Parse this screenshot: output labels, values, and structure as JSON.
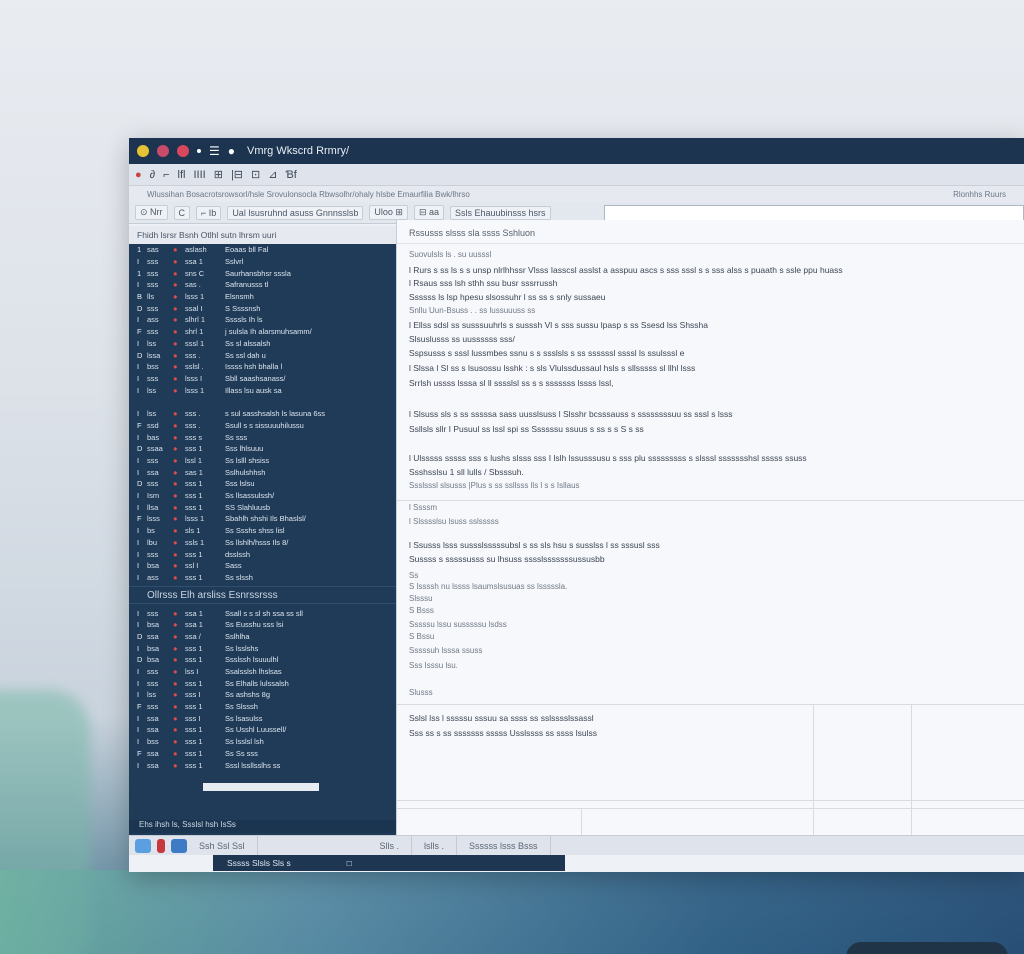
{
  "window": {
    "title": "Vmrg Wkscrd Rrmry/",
    "titlebar_colors": [
      "#e6c235",
      "#c94a6b",
      "#d8475c"
    ]
  },
  "toolbar": {
    "items": [
      "●",
      "∂",
      "⌐",
      "lfl",
      "IIII",
      "⊞",
      "|⊟",
      "⊡",
      "⊿",
      "Ɓf"
    ]
  },
  "pathbar": {
    "left": "Wlussihan Bosacrotsrowsorl/hsle Srovulonsocla Rbwsolhr/ohaly hlsbe Emaurfilia Bwk/lhrso",
    "right": "Rlonhhs Ruurs"
  },
  "navbar": {
    "back": "⊙ Nrr",
    "c": "C",
    "path1": "⌐ Ib",
    "crumbs": "Ual lsusruhnd asuss Gnnnsslsb",
    "grid": "Uloo ⊞",
    "folder": "⊟ aa",
    "item3": "Ssls Ehauubinsss hsrs",
    "address": ""
  },
  "sidebar": {
    "header": "Fhidh lsrsr Bsnh Otlhl sutn lhrsm uuri",
    "rows": [
      [
        "1",
        "sas",
        "●",
        "aslash",
        "Eoaas bll Fal"
      ],
      [
        "I",
        "sss",
        "●",
        "ssa  1",
        "Sslvrl"
      ],
      [
        "1",
        "sss",
        "●",
        "sns  C",
        "Saurhansbhsr sssla"
      ],
      [
        "I",
        "sss",
        "●",
        "sas  .",
        "Safranusss tl"
      ],
      [
        "B",
        "lls",
        "●",
        "lsss  1",
        "Elsnsmh"
      ],
      [
        "D",
        "sss",
        "●",
        "ssal  I",
        "S Ssssnsh"
      ],
      [
        "I",
        "ass",
        "●",
        "slhrl  1",
        "Ssssls Ih ls"
      ],
      [
        "F",
        "sss",
        "●",
        "shrl  1",
        "j sulsla Ih alarsmuhsamm/"
      ],
      [
        "I",
        "lss",
        "●",
        "sssl  1",
        "Ss sl alssalsh"
      ],
      [
        "D",
        "lssa",
        "●",
        "sss  .",
        "Ss ssl dah u"
      ],
      [
        "I",
        "bss",
        "●",
        "sslsl  .",
        "Issss hsh bhalla  l"
      ],
      [
        "I",
        "sss",
        "●",
        "lsss  I",
        "Sbll saashsanass/"
      ],
      [
        "I",
        "lss",
        "●",
        "lsss  1",
        "Illass lsu ausk sa"
      ]
    ],
    "rows2": [
      [
        "I",
        "lss",
        "●",
        "sss  .",
        "s sul sasshsalsh ls lasuna 6ss"
      ],
      [
        "F",
        "ssd",
        "●",
        "sss  .",
        "Ssull s s sissuuuhilussu"
      ],
      [
        "I",
        "bas",
        "●",
        "sss  s",
        "Ss sss"
      ],
      [
        "D",
        "ssaa",
        "●",
        "sss  1",
        "Sss lhlsuuu"
      ],
      [
        "I",
        "sss",
        "●",
        "lssl  1",
        "Ss lslll shsiss"
      ],
      [
        "I",
        "ssa",
        "●",
        "sas  1",
        "Sslhulshhsh"
      ],
      [
        "D",
        "sss",
        "●",
        "sss  1",
        "Sss lslsu"
      ],
      [
        "I",
        "Ism",
        "●",
        "sss  1",
        "Ss llsassulssh/"
      ],
      [
        "I",
        "llsa",
        "●",
        "sss  1",
        "SS Slahluusb"
      ],
      [
        "F",
        "lsss",
        "●",
        "lsss  1",
        "Sbahlh shshi Ils Bhaslsl/"
      ],
      [
        "I",
        "bs",
        "●",
        "sls  1",
        "Ss Ssshs shss lisl"
      ],
      [
        "I",
        "lbu",
        "●",
        "ssls  1",
        "Ss llshlh/hsss Ils 8/"
      ],
      [
        "I",
        "sss",
        "●",
        "sss  1",
        "dsslssh"
      ],
      [
        "I",
        "bsa",
        "●",
        "ssl  I",
        "Sass"
      ],
      [
        "I",
        "ass",
        "●",
        "sss  1",
        "Ss slssh"
      ]
    ],
    "section": "Ollrsss Elh  arsliss Esnrssrsss",
    "rows3": [
      [
        "I",
        "sss",
        "●",
        "ssa  1",
        "Ssall s s sl sh  ssa ss sll"
      ],
      [
        "I",
        "bsa",
        "●",
        "ssa  1",
        "Ss Eusshu sss lsi"
      ],
      [
        "D",
        "ssa",
        "●",
        "ssa  /",
        "Sslhlha"
      ],
      [
        "I",
        "bsa",
        "●",
        "sss  1",
        "Ss lsslshs"
      ],
      [
        "D",
        "bsa",
        "●",
        "sss  1",
        "Ssslssh lsuuulhl"
      ],
      [
        "I",
        "sss",
        "●",
        "lss  I",
        "Ssalsslsh lhslsas"
      ],
      [
        "I",
        "sss",
        "●",
        "sss  1",
        "Ss Elhalls lulssalsh"
      ],
      [
        "I",
        "lss",
        "●",
        "sss  I",
        "Ss ashshs 8g"
      ],
      [
        "F",
        "sss",
        "●",
        "sss  1",
        "Ss Slsssh"
      ],
      [
        "I",
        "ssa",
        "●",
        "sss  I",
        "Ss lsasulss"
      ],
      [
        "I",
        "ssa",
        "●",
        "sss  1",
        "Ss Usshl Luussell/"
      ],
      [
        "I",
        "bss",
        "●",
        "sss  1",
        "Ss lsslsl lsh"
      ],
      [
        "F",
        "ssa",
        "●",
        "sss  1",
        "Ss Ss sss"
      ],
      [
        "I",
        "ssa",
        "●",
        "sss  1",
        "Sssl lssllsslhs ss"
      ]
    ],
    "footer": "Ehs ihsh ls,  Ssslsl hsh IsSs"
  },
  "main": {
    "head": "Rssusss slsss sla ssss Sshluon",
    "lines": [
      {
        "t": "Suovulsls ls  . su uusssl",
        "dim": true
      },
      {
        "t": "l  Rurs s ss ls s s   unsp nlrlhhssr Vlsss Iasscsl asslst  a asspuu ascs s sss sssl s s sss alss s puaath  s ssle ppu huass",
        "dim": false
      },
      {
        "t": "l  Rsaus sss lsh sthh ssu  busr sssrrussh",
        "dim": false
      },
      {
        "t": "   Ssssss ls lsp hpesu slsossuhr l ss ss s snly  sussaeu",
        "dim": false
      },
      {
        "t": "   Snllu Uun-Bsuss  .  .  ss  lussuuuss  ss",
        "dim": true
      },
      {
        "t": "l  Ellss sdsl ss susssuuhrls s susssh  Vl s sss sussu lpasp s ss   Ssesd lss Shssha",
        "dim": false
      },
      {
        "t": "   Slsuslusss ss  uussssss sss/",
        "dim": false
      },
      {
        "t": "   Sspsusss s sssl lussmbes ssnu  s  s ssslsls  s ss ssssssl  ssssl ls ssulsssl  e",
        "dim": false
      },
      {
        "t": "l  Slssa l Sl  ss s lsusossu lsshk :  s sls  Vlulssdussaul hsls  s sllsssss sl llhl lsss",
        "dim": false
      },
      {
        "t": "   Srrlsh ussss lsssa sl ll sssslsl ss s s sssssss lssss lssl,",
        "dim": false
      },
      {
        "t": "l  Slsuss sls s ss sssssa sass  uusslsuss l Slsshr bcsssauss  s  ssssssssuu  ss sssl s lsss",
        "dim": false
      },
      {
        "t": "   Ssllsls sllr  I  Pusuul ss lssl spi ss Ssssssu ssuus s  ss  s  s S s ss",
        "dim": false
      },
      {
        "t": "l  Ulsssss sssss sss s lushs  slsss sss I lslh lssusssusu   s sss plu  sssssssss  s  slsssl ssssssshsl sssss ssuss",
        "dim": false
      },
      {
        "t": "   Ssshsslsu  1  sll lulls  / Sbsssuh.",
        "dim": false
      },
      {
        "t": "   Ssslsssl slsusss   |Plus s ss ssllsss  lls l s s Isllaus",
        "dim": true
      },
      {
        "t": "l  Ssssm",
        "dim": true
      },
      {
        "t": "l  Slsssslsu lsuss  sslsssss",
        "dim": true
      },
      {
        "t": "l  Ssusss lsss sussslsssssubsl s ss sls hsu s susslss l ss sssusl sss",
        "dim": false
      },
      {
        "t": "   Sussss s sssssusss su lhsuss sssslsssssssussusbb",
        "dim": false
      },
      {
        "t": "Ss",
        "dim": true
      },
      {
        "t": "S lssssh nu lssss lsaumslsusuas ss lsssssla.",
        "dim": true
      },
      {
        "t": "Slsssu",
        "dim": true
      },
      {
        "t": "S Bsss",
        "dim": true
      },
      {
        "t": "Sssssu lssu susssssu lsdss",
        "dim": true
      },
      {
        "t": "S Bssu",
        "dim": true
      },
      {
        "t": "Sssssuh lsssa ssuss",
        "dim": true
      },
      {
        "t": "Sss Isssu lsu.",
        "dim": true
      },
      {
        "t": "Slusss",
        "dim": true
      },
      {
        "t": "Sslsl lss l sssssu sssuu sa ssss  ss sslsssslssassl",
        "dim": false
      },
      {
        "t": "Sss ss s ss  sssssss sssss Usslssss ss ssss lsulss",
        "dim": false
      }
    ]
  },
  "statusbar": {
    "item1": "Ssh  Ssl  Ssl",
    "item2": "Slls  .",
    "item3": "lslls  .",
    "item4": "Ssssss lsss  Bsss"
  },
  "taskbar": {
    "item1": "Sssss  Slsls  Sls  s",
    "item2": "□"
  }
}
